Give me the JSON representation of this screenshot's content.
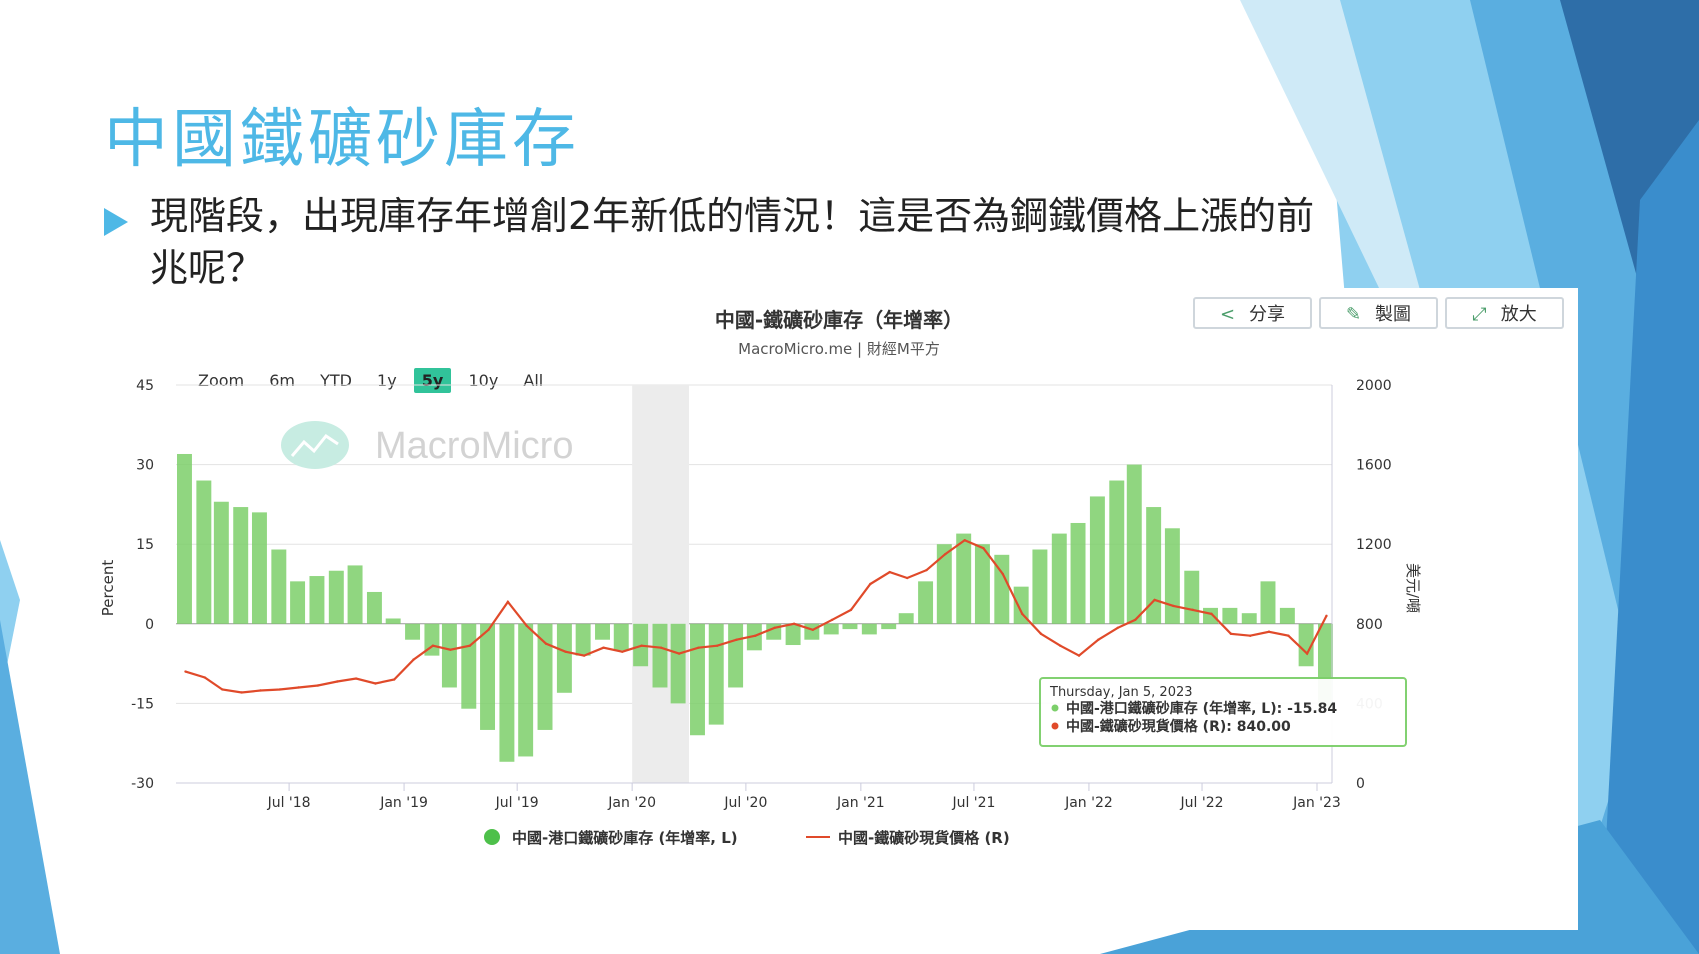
{
  "slide": {
    "title": "中國鐵礦砂庫存",
    "bullet": "現階段，出現庫存年增創2年新低的情況！這是否為鋼鐵價格上漲的前兆呢？"
  },
  "toolbar": {
    "share": "分享",
    "draw": "製圖",
    "zoom": "放大"
  },
  "zoom_bar": {
    "label": "Zoom",
    "options": [
      "6m",
      "YTD",
      "1y",
      "5y",
      "10y",
      "All"
    ],
    "active": "5y"
  },
  "watermark": "MacroMicro",
  "tooltip": {
    "date": "Thursday, Jan 5, 2023",
    "line1": "中國-港口鐵礦砂庫存 (年增率, L): -15.84",
    "line2": "中國-鐵礦砂現貨價格 (R): 840.00"
  },
  "colors": {
    "accent": "#4eb8e6",
    "bar": "#7ccf6a",
    "line": "#e04a2a",
    "zoom_active": "#31c39a"
  },
  "chart_data": {
    "type": "bar+line",
    "title": "中國-鐵礦砂庫存（年增率）",
    "subtitle": "MacroMicro.me | 財經M平方",
    "ylabel_left": "Percent",
    "ylabel_right": "美元/噸",
    "y_left_ticks": [
      45,
      30,
      15,
      0,
      -15,
      -30
    ],
    "y_right_ticks": [
      2000,
      1600,
      1200,
      800,
      400,
      0
    ],
    "ylim_left": [
      -30,
      45
    ],
    "ylim_right": [
      0,
      2000
    ],
    "x_ticks": [
      "Jul '18",
      "Jan '19",
      "Jul '19",
      "Jan '20",
      "Jul '20",
      "Jan '21",
      "Jul '21",
      "Jan '22",
      "Jul '22",
      "Jan '23"
    ],
    "x_range": [
      "2018-01",
      "2023-01"
    ],
    "shaded_period": [
      "2020-01",
      "2020-04"
    ],
    "legend_position": "bottom",
    "series": [
      {
        "name": "中國-港口鐵礦砂庫存 (年增率, L)",
        "type": "bar",
        "axis": "left",
        "x": [
          "2018-01",
          "2018-02",
          "2018-03",
          "2018-04",
          "2018-05",
          "2018-06",
          "2018-07",
          "2018-08",
          "2018-09",
          "2018-10",
          "2018-11",
          "2018-12",
          "2019-01",
          "2019-02",
          "2019-03",
          "2019-04",
          "2019-05",
          "2019-06",
          "2019-07",
          "2019-08",
          "2019-09",
          "2019-10",
          "2019-11",
          "2019-12",
          "2020-01",
          "2020-02",
          "2020-03",
          "2020-04",
          "2020-05",
          "2020-06",
          "2020-07",
          "2020-08",
          "2020-09",
          "2020-10",
          "2020-11",
          "2020-12",
          "2021-01",
          "2021-02",
          "2021-03",
          "2021-04",
          "2021-05",
          "2021-06",
          "2021-07",
          "2021-08",
          "2021-09",
          "2021-10",
          "2021-11",
          "2021-12",
          "2022-01",
          "2022-02",
          "2022-03",
          "2022-04",
          "2022-05",
          "2022-06",
          "2022-07",
          "2022-08",
          "2022-09",
          "2022-10",
          "2022-11",
          "2022-12",
          "2023-01"
        ],
        "values": [
          32,
          27,
          23,
          22,
          21,
          14,
          8,
          9,
          10,
          11,
          6,
          1,
          -3,
          -6,
          -12,
          -16,
          -20,
          -26,
          -25,
          -20,
          -13,
          -6,
          -3,
          -5,
          -8,
          -12,
          -15,
          -21,
          -19,
          -12,
          -5,
          -3,
          -4,
          -3,
          -2,
          -1,
          -2,
          -1,
          2,
          8,
          15,
          17,
          15,
          13,
          7,
          14,
          17,
          19,
          24,
          27,
          30,
          22,
          18,
          10,
          3,
          3,
          2,
          8,
          3,
          -8,
          -15.84
        ]
      },
      {
        "name": "中國-鐵礦砂現貨價格 (R)",
        "type": "line",
        "axis": "right",
        "x": [
          "2018-01",
          "2018-02",
          "2018-03",
          "2018-04",
          "2018-05",
          "2018-06",
          "2018-07",
          "2018-08",
          "2018-09",
          "2018-10",
          "2018-11",
          "2018-12",
          "2019-01",
          "2019-02",
          "2019-03",
          "2019-04",
          "2019-05",
          "2019-06",
          "2019-07",
          "2019-08",
          "2019-09",
          "2019-10",
          "2019-11",
          "2019-12",
          "2020-01",
          "2020-02",
          "2020-03",
          "2020-04",
          "2020-05",
          "2020-06",
          "2020-07",
          "2020-08",
          "2020-09",
          "2020-10",
          "2020-11",
          "2020-12",
          "2021-01",
          "2021-02",
          "2021-03",
          "2021-04",
          "2021-05",
          "2021-06",
          "2021-07",
          "2021-08",
          "2021-09",
          "2021-10",
          "2021-11",
          "2021-12",
          "2022-01",
          "2022-02",
          "2022-03",
          "2022-04",
          "2022-05",
          "2022-06",
          "2022-07",
          "2022-08",
          "2022-09",
          "2022-10",
          "2022-11",
          "2022-12",
          "2023-01"
        ],
        "values": [
          560,
          530,
          470,
          455,
          465,
          470,
          480,
          490,
          510,
          525,
          500,
          520,
          620,
          690,
          670,
          690,
          770,
          910,
          790,
          700,
          660,
          640,
          680,
          660,
          690,
          680,
          650,
          680,
          690,
          720,
          740,
          780,
          800,
          770,
          820,
          870,
          1000,
          1060,
          1030,
          1070,
          1150,
          1220,
          1180,
          1050,
          850,
          750,
          690,
          640,
          720,
          780,
          820,
          920,
          890,
          870,
          850,
          750,
          740,
          760,
          740,
          650,
          840
        ]
      }
    ]
  },
  "legend": {
    "bar_label": "中國-港口鐵礦砂庫存 (年增率, L)",
    "line_label": "中國-鐵礦砂現貨價格 (R)"
  }
}
